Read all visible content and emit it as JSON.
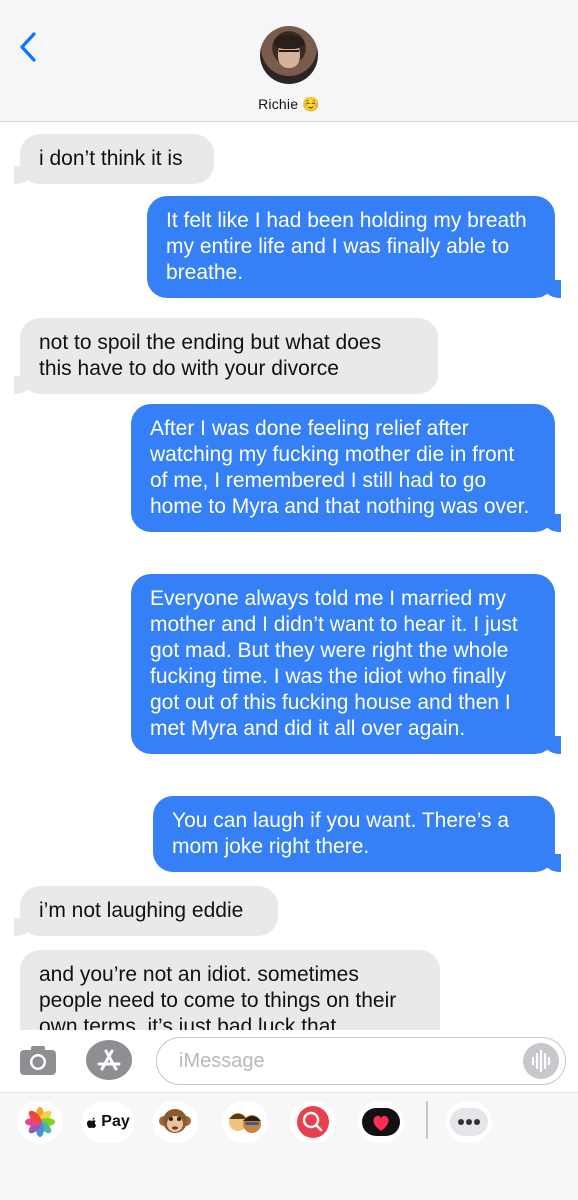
{
  "header": {
    "contact_name": "Richie ☺️"
  },
  "messages": [
    {
      "side": "incoming",
      "text": "i don’t think it is"
    },
    {
      "side": "outgoing",
      "text": "It felt like I had been holding my breath my entire life and I was finally able to breathe."
    },
    {
      "side": "incoming",
      "text": "not to spoil the ending but what does this have to do with your divorce"
    },
    {
      "side": "outgoing",
      "text": "After I was done feeling relief after watching my fucking mother die in front of me, I remembered I still had to go home to Myra and that nothing was over."
    },
    {
      "side": "outgoing",
      "text": "Everyone always told me I married my mother and I didn’t want to hear it. I just got mad. But they were right the whole fucking time. I was the idiot who finally got out of this fucking house and then I met Myra and did it all over again."
    },
    {
      "side": "outgoing",
      "text": "You can laugh if you want. There’s a mom joke right there."
    },
    {
      "side": "incoming",
      "text": "i’m not laughing eddie"
    },
    {
      "side": "incoming",
      "text": "and you’re not an idiot. sometimes people need to come to things on their own terms. it’s just bad luck that"
    }
  ],
  "composer": {
    "placeholder": "iMessage"
  },
  "app_drawer": {
    "apple_pay_label": "Pay",
    "apps": [
      "photos-app-icon",
      "apple-pay-icon",
      "animoji-monkey-icon",
      "memoji-icon",
      "search-images-icon",
      "digital-touch-icon",
      "more-apps-icon"
    ]
  },
  "colors": {
    "outgoing_bubble": "#3580f6",
    "incoming_bubble": "#e9e9eb",
    "accent": "#007aff"
  }
}
